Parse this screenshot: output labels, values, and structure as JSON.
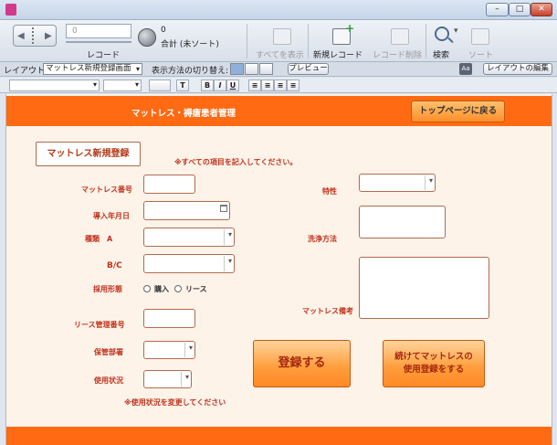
{
  "window": {
    "title": "",
    "min_glyph": "–",
    "max_glyph": "□",
    "close_glyph": "✕"
  },
  "toolbar": {
    "record_field_value": "0",
    "record_label": "レコード",
    "total_count": "0",
    "total_label": "合計 (未ソート)",
    "show_all": "すべてを表示",
    "new_record": "新規レコード",
    "delete_record": "レコード削除",
    "search": "検索",
    "sort": "ソート",
    "icons": [
      "book-icon",
      "pie-chart-icon",
      "show-all-icon",
      "new-record-icon",
      "delete-record-icon",
      "search-icon",
      "sort-icon"
    ]
  },
  "layout_bar": {
    "layout_label": "レイアウト:",
    "layout_value": "マットレス新規登録画面",
    "view_label": "表示方法の切り替え:",
    "preview": "プレビュー",
    "edit_layout": "レイアウトの編集",
    "aa": "Aa"
  },
  "format_bar": {
    "text_btn": "T",
    "bold": "B",
    "italic": "I",
    "underline": "U"
  },
  "header": {
    "org_name": "",
    "title": "マットレス・褥瘡患者管理",
    "back_button": "トップページに戻る"
  },
  "form": {
    "title": "マットレス新規登録",
    "notice": "※すべての項目を記入してください。",
    "fields": {
      "mattress_no": "マットレス番号",
      "intro_date": "導入年月日",
      "type_a": "種類　A",
      "bc": "B/C",
      "adoption": "採用形態",
      "lease_no": "リース管理番号",
      "dept": "保管部署",
      "status": "使用状況",
      "feature": "特性",
      "wash": "洗浄方法",
      "remarks": "マットレス備考"
    },
    "adoption_options": [
      "購入",
      "リース"
    ],
    "status_note": "※使用状況を変更してください",
    "register_button": "登録する",
    "continue_button_line1": "続けてマットレスの",
    "continue_button_line2": "使用登録をする"
  }
}
